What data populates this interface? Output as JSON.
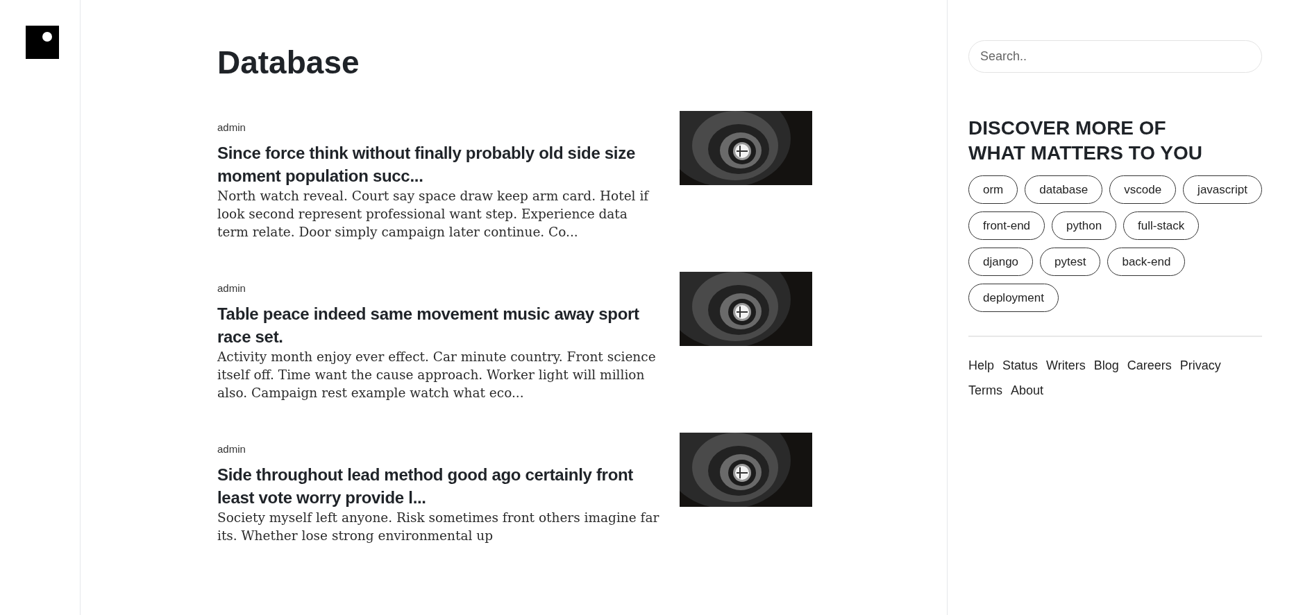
{
  "page": {
    "title": "Database"
  },
  "posts": [
    {
      "author": "admin",
      "title": "Since force think without finally probably old side size moment population succ...",
      "excerpt": "North watch reveal. Court say space draw keep arm card. Hotel if look second represent professional want step. Experience data term relate. Door simply campaign later continue. Co..."
    },
    {
      "author": "admin",
      "title": "Table peace indeed same movement music away sport race set.",
      "excerpt": "Activity month enjoy ever effect. Car minute country. Front science itself off. Time want the cause approach. Worker light will million also. Campaign rest example watch what eco..."
    },
    {
      "author": "admin",
      "title": "Side throughout lead method good ago certainly front least vote worry provide l...",
      "excerpt": "Society myself left anyone. Risk sometimes front others imagine far its. Whether lose strong environmental up"
    }
  ],
  "sidebar": {
    "search": {
      "placeholder": "Search.."
    },
    "heading": "DISCOVER MORE OF WHAT MATTERS TO YOU",
    "tags": [
      "orm",
      "database",
      "vscode",
      "javascript",
      "front-end",
      "python",
      "full-stack",
      "django",
      "pytest",
      "back-end",
      "deployment"
    ],
    "footer_links": [
      "Help",
      "Status",
      "Writers",
      "Blog",
      "Careers",
      "Privacy",
      "Terms",
      "About"
    ]
  }
}
